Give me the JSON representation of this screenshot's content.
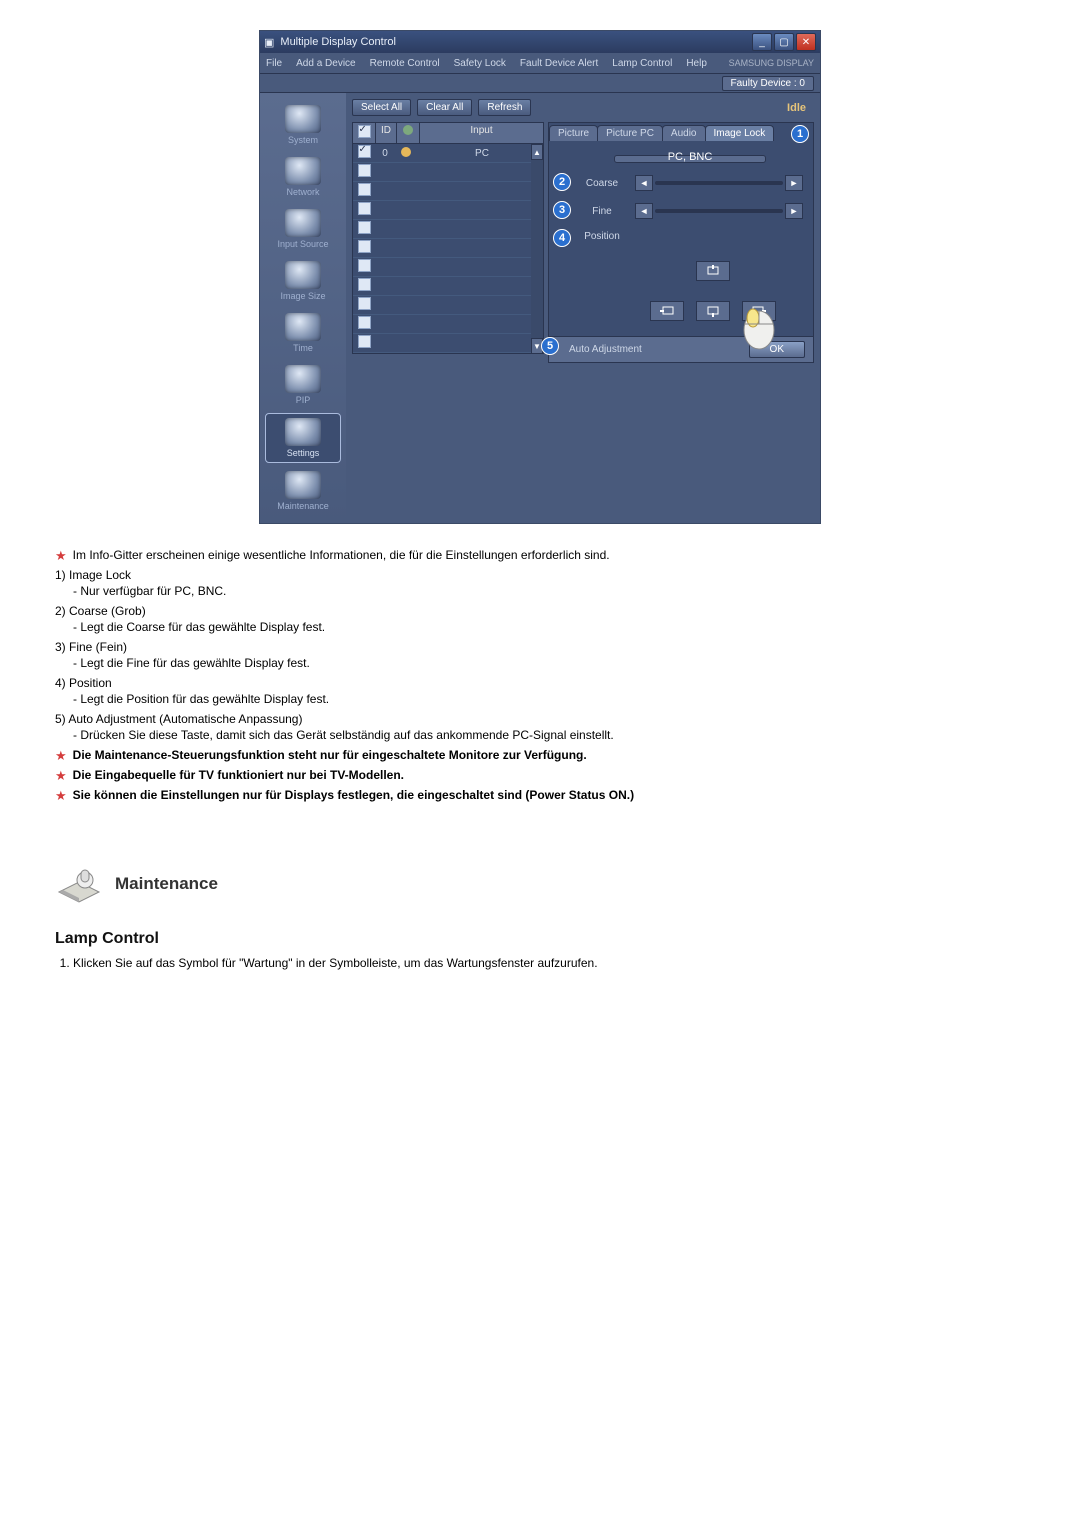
{
  "app": {
    "title": "Multiple Display Control",
    "menus": [
      "File",
      "Add a Device",
      "Remote Control",
      "Safety Lock",
      "Fault Device Alert",
      "Lamp Control",
      "Help"
    ],
    "brand": "SAMSUNG DISPLAY",
    "faulty": "Faulty Device : 0",
    "toolbar": {
      "select_all": "Select All",
      "clear_all": "Clear All",
      "refresh": "Refresh"
    },
    "idle": "Idle",
    "sidebar": [
      "System",
      "Network",
      "Input Source",
      "Image Size",
      "Time",
      "PIP",
      "Settings",
      "Maintenance"
    ],
    "sidebar_active_index": 6,
    "list": {
      "headers": [
        "",
        "ID",
        "",
        "Input"
      ],
      "rows": [
        {
          "checked": true,
          "id": "0",
          "dot": "amber",
          "input": "PC"
        },
        {
          "checked": false,
          "id": "",
          "dot": "",
          "input": ""
        },
        {
          "checked": false,
          "id": "",
          "dot": "",
          "input": ""
        },
        {
          "checked": false,
          "id": "",
          "dot": "",
          "input": ""
        },
        {
          "checked": false,
          "id": "",
          "dot": "",
          "input": ""
        },
        {
          "checked": false,
          "id": "",
          "dot": "",
          "input": ""
        },
        {
          "checked": false,
          "id": "",
          "dot": "",
          "input": ""
        },
        {
          "checked": false,
          "id": "",
          "dot": "",
          "input": ""
        },
        {
          "checked": false,
          "id": "",
          "dot": "",
          "input": ""
        },
        {
          "checked": false,
          "id": "",
          "dot": "",
          "input": ""
        },
        {
          "checked": false,
          "id": "",
          "dot": "",
          "input": ""
        }
      ]
    },
    "tabs": [
      "Picture",
      "Picture PC",
      "Audio",
      "Image Lock"
    ],
    "active_tab": 3,
    "source": "PC, BNC",
    "controls": {
      "coarse": "Coarse",
      "fine": "Fine",
      "position": "Position"
    },
    "auto": {
      "label": "Auto Adjustment",
      "ok": "OK"
    },
    "callouts": [
      "1",
      "2",
      "3",
      "4",
      "5"
    ]
  },
  "notes": {
    "intro": "Im Info-Gitter erscheinen einige wesentliche Informationen, die für die Einstellungen erforderlich sind.",
    "items": [
      {
        "n": "1)",
        "t": "Image Lock",
        "sub": "- Nur verfügbar für PC, BNC."
      },
      {
        "n": "2)",
        "t": "Coarse (Grob)",
        "sub": "- Legt die Coarse für das gewählte Display fest."
      },
      {
        "n": "3)",
        "t": "Fine (Fein)",
        "sub": "- Legt die Fine für das gewählte Display fest."
      },
      {
        "n": "4)",
        "t": "Position",
        "sub": "- Legt die Position für das gewählte Display fest."
      },
      {
        "n": "5)",
        "t": "Auto Adjustment (Automatische Anpassung)",
        "sub": "- Drücken Sie diese Taste, damit sich das Gerät selbständig auf das ankommende PC-Signal einstellt."
      }
    ],
    "warnings": [
      "Die Maintenance-Steuerungsfunktion steht nur für eingeschaltete Monitore zur Verfügung.",
      "Die Eingabequelle für TV funktioniert nur bei TV-Modellen.",
      "Sie können die Einstellungen nur für Displays festlegen, die eingeschaltet sind (Power Status ON.)"
    ]
  },
  "maint": {
    "heading": "Maintenance",
    "sub": "Lamp Control",
    "step1": "Klicken Sie auf das Symbol für \"Wartung\" in der Symbolleiste, um das Wartungsfenster aufzurufen."
  }
}
